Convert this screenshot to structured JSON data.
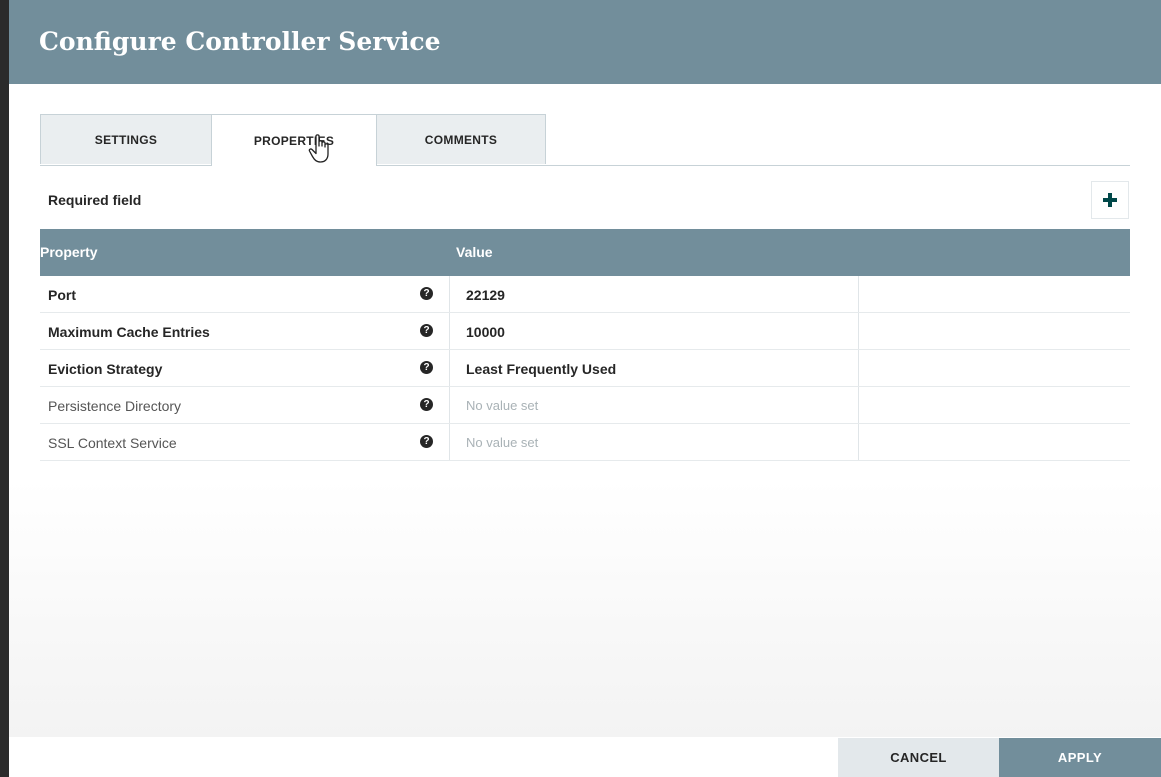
{
  "dialog": {
    "title": "Configure Controller Service"
  },
  "tabs": [
    {
      "label": "SETTINGS",
      "active": false
    },
    {
      "label": "PROPERTIES",
      "active": true
    },
    {
      "label": "COMMENTS",
      "active": false
    }
  ],
  "toolbar": {
    "required_label": "Required field",
    "add_icon": "plus-icon"
  },
  "grid": {
    "columns": [
      "Property",
      "Value"
    ],
    "rows": [
      {
        "property": "Port",
        "value": "22129",
        "required": true
      },
      {
        "property": "Maximum Cache Entries",
        "value": "10000",
        "required": true
      },
      {
        "property": "Eviction Strategy",
        "value": "Least Frequently Used",
        "required": true
      },
      {
        "property": "Persistence Directory",
        "value": "No value set",
        "required": false
      },
      {
        "property": "SSL Context Service",
        "value": "No value set",
        "required": false
      }
    ],
    "help_icon": "question-circle-icon"
  },
  "footer": {
    "cancel_label": "CANCEL",
    "apply_label": "APPLY"
  },
  "colors": {
    "header": "#728e9b",
    "cancel_bg": "#e3e8eb",
    "unset_text": "#a9b2b6"
  }
}
